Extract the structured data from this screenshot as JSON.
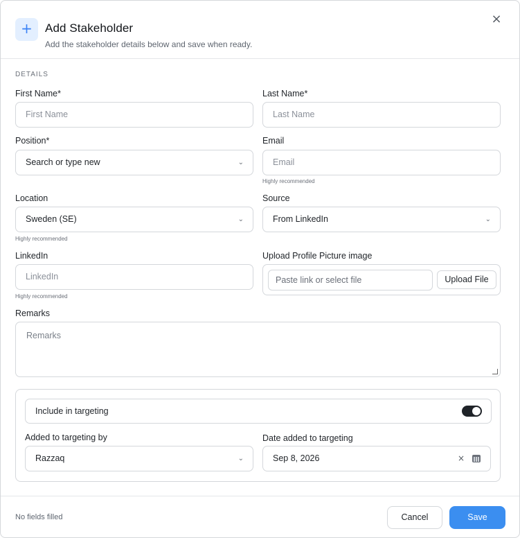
{
  "dialog": {
    "title": "Add Stakeholder",
    "subtitle": "Add the stakeholder details below and save when ready.",
    "header_icon": "+",
    "close_icon": "×"
  },
  "section": {
    "label": "DETAILS"
  },
  "fields": {
    "first_name": {
      "label": "First Name*",
      "placeholder": "First Name"
    },
    "last_name": {
      "label": "Last Name*",
      "placeholder": "Last Name"
    },
    "position": {
      "label": "Position*",
      "placeholder": "Search or type new"
    },
    "email": {
      "label": "Email",
      "placeholder": "Email",
      "hint": "Highly recommended"
    },
    "location": {
      "label": "Location",
      "value": "Sweden (SE)",
      "hint": "Highly recommended"
    },
    "source": {
      "label": "Source",
      "value": "From LinkedIn"
    },
    "linkedin": {
      "label": "LinkedIn",
      "placeholder": "LinkedIn",
      "hint": "Highly recommended"
    },
    "upload": {
      "label": "Upload Profile Picture image",
      "placeholder": "Paste link or select file",
      "button": "Upload File"
    },
    "remarks": {
      "label": "Remarks",
      "placeholder": "Remarks"
    }
  },
  "targeting": {
    "toggle_label": "Include in targeting",
    "toggle_on": true,
    "added_by": {
      "label": "Added to targeting by",
      "value": "Razzaq"
    },
    "date_added": {
      "label": "Date added to targeting",
      "value": "Sep 8, 2026",
      "clear_icon": "×"
    }
  },
  "footer": {
    "status": "No fields filled",
    "cancel": "Cancel",
    "save": "Save"
  },
  "icons": {
    "chevron": "⌄"
  },
  "colors": {
    "accent": "#3b8ef0",
    "header_icon_bg": "#e3efff",
    "toggle_on": "#1f2328"
  }
}
